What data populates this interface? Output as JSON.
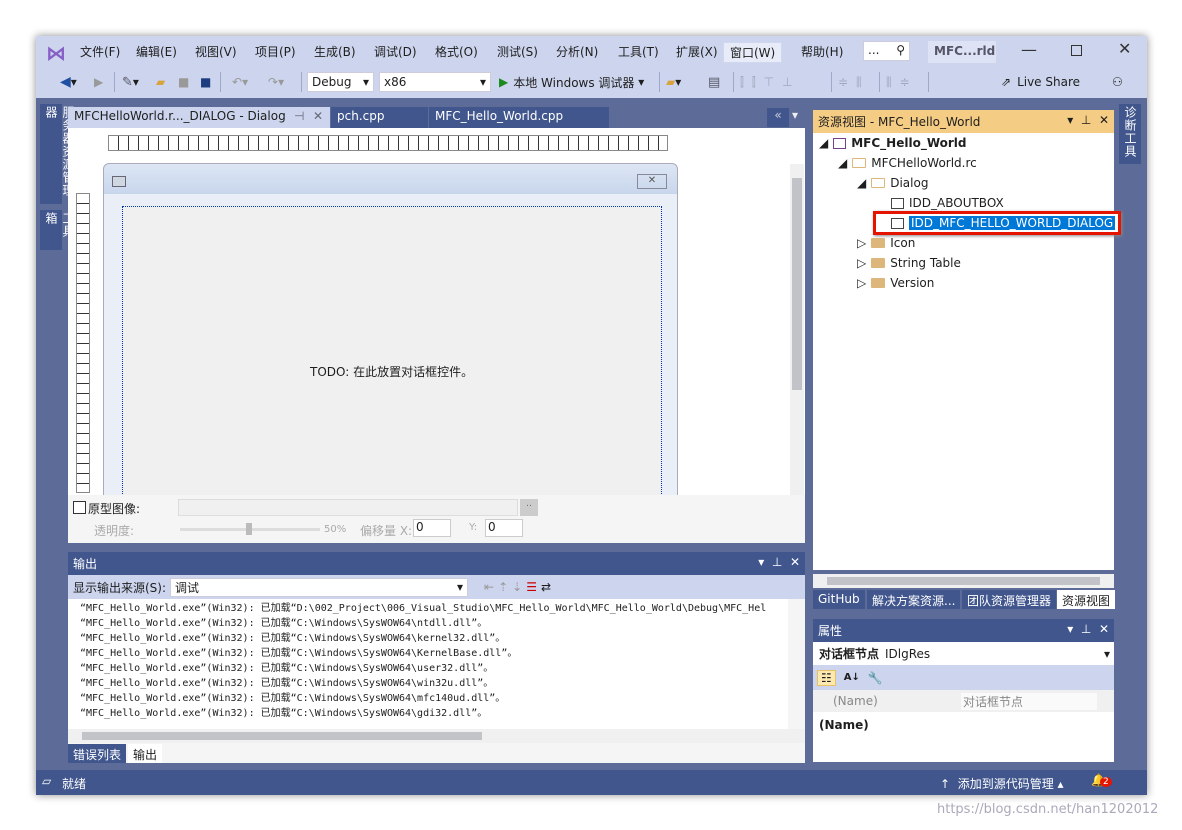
{
  "menu": [
    "文件(F)",
    "编辑(E)",
    "视图(V)",
    "项目(P)",
    "生成(B)",
    "调试(D)",
    "格式(O)",
    "测试(S)",
    "分析(N)",
    "工具(T)",
    "扩展(X)",
    "窗口(W)",
    "帮助(H)"
  ],
  "search": {
    "placeholder": "..."
  },
  "window_title": "MFC...rld",
  "toolbar": {
    "config": "Debug",
    "platform": "x86",
    "run": "本地 Windows 调试器",
    "live_share": "Live Share"
  },
  "left_strip": [
    "服务器资源管理器",
    "工具箱"
  ],
  "right_strip": "诊断工具",
  "doc_tabs": [
    "MFCHelloWorld.r..._DIALOG - Dialog",
    "pch.cpp",
    "MFC_Hello_World.cpp"
  ],
  "designer": {
    "todo": "TODO: 在此放置对话框控件。",
    "prototype_label": "原型图像:",
    "opacity_label": "透明度:",
    "opacity_value": "50%",
    "opacity_percent": 50,
    "offset_label": "偏移量 X:",
    "x": "0",
    "y_label": "Y:",
    "y": "0"
  },
  "output": {
    "title": "输出",
    "source_label": "显示输出来源(S):",
    "source_value": "调试",
    "lines": [
      "“MFC_Hello_World.exe”(Win32): 已加载“D:\\002_Project\\006_Visual_Studio\\MFC_Hello_World\\MFC_Hello_World\\Debug\\MFC_Hel",
      "“MFC_Hello_World.exe”(Win32): 已加载“C:\\Windows\\SysWOW64\\ntdll.dll”。",
      "“MFC_Hello_World.exe”(Win32): 已加载“C:\\Windows\\SysWOW64\\kernel32.dll”。",
      "“MFC_Hello_World.exe”(Win32): 已加载“C:\\Windows\\SysWOW64\\KernelBase.dll”。",
      "“MFC_Hello_World.exe”(Win32): 已加载“C:\\Windows\\SysWOW64\\user32.dll”。",
      "“MFC_Hello_World.exe”(Win32): 已加载“C:\\Windows\\SysWOW64\\win32u.dll”。",
      "“MFC_Hello_World.exe”(Win32): 已加载“C:\\Windows\\SysWOW64\\mfc140ud.dll”。",
      "“MFC_Hello_World.exe”(Win32): 已加载“C:\\Windows\\SysWOW64\\gdi32.dll”。"
    ],
    "tabs": [
      "错误列表",
      "输出"
    ]
  },
  "resource_view": {
    "title": "资源视图 - MFC_Hello_World",
    "tree": [
      "MFC_Hello_World",
      "MFCHelloWorld.rc",
      "Dialog",
      "IDD_ABOUTBOX",
      "IDD_MFC_HELLO_WORLD_DIALOG",
      "Icon",
      "String Table",
      "Version"
    ],
    "tabs": [
      "GitHub",
      "解决方案资源...",
      "团队资源管理器",
      "资源视图"
    ]
  },
  "properties": {
    "title": "属性",
    "object": "对话框节点",
    "object_type": "IDlgRes",
    "row_name": "(Name)",
    "row_value": "对话框节点",
    "desc_title": "(Name)"
  },
  "status": {
    "left": "就绪",
    "source_control": "添加到源代码管理",
    "notifications": "2"
  },
  "watermark": "https://blog.csdn.net/han1202012",
  "colors": {
    "accent": "#007acc",
    "panel_bg": "#5d6b99",
    "header_active": "#f5cc84",
    "selection_box": "#e51400"
  }
}
